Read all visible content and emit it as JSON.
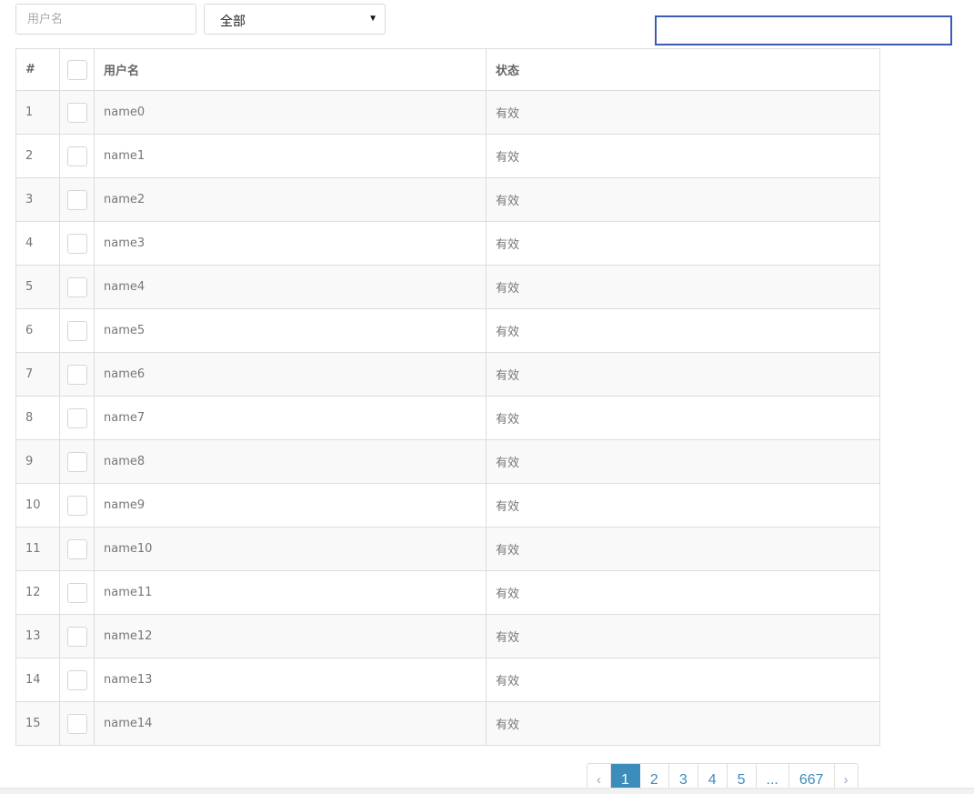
{
  "toolbar": {
    "search_placeholder": "用户名",
    "status_selected": "全部"
  },
  "table": {
    "headers": {
      "index": "#",
      "username": "用户名",
      "status": "状态"
    },
    "rows": [
      {
        "index": "1",
        "username": "name0",
        "status": "有效"
      },
      {
        "index": "2",
        "username": "name1",
        "status": "有效"
      },
      {
        "index": "3",
        "username": "name2",
        "status": "有效"
      },
      {
        "index": "4",
        "username": "name3",
        "status": "有效"
      },
      {
        "index": "5",
        "username": "name4",
        "status": "有效"
      },
      {
        "index": "6",
        "username": "name5",
        "status": "有效"
      },
      {
        "index": "7",
        "username": "name6",
        "status": "有效"
      },
      {
        "index": "8",
        "username": "name7",
        "status": "有效"
      },
      {
        "index": "9",
        "username": "name8",
        "status": "有效"
      },
      {
        "index": "10",
        "username": "name9",
        "status": "有效"
      },
      {
        "index": "11",
        "username": "name10",
        "status": "有效"
      },
      {
        "index": "12",
        "username": "name11",
        "status": "有效"
      },
      {
        "index": "13",
        "username": "name12",
        "status": "有效"
      },
      {
        "index": "14",
        "username": "name13",
        "status": "有效"
      },
      {
        "index": "15",
        "username": "name14",
        "status": "有效"
      }
    ]
  },
  "pagination": {
    "prev": "‹",
    "pages": [
      "1",
      "2",
      "3",
      "4",
      "5",
      "...",
      "667"
    ],
    "current": "1",
    "next": "›"
  },
  "colors": {
    "accent": "#3c8dbc",
    "focus_outline": "#3b5bb5",
    "row_stripe": "#f9f9f9",
    "border": "#dddddd"
  },
  "icons": {
    "select_arrow": "caret-down-icon",
    "prev": "chevron-left-icon",
    "next": "chevron-right-icon"
  }
}
